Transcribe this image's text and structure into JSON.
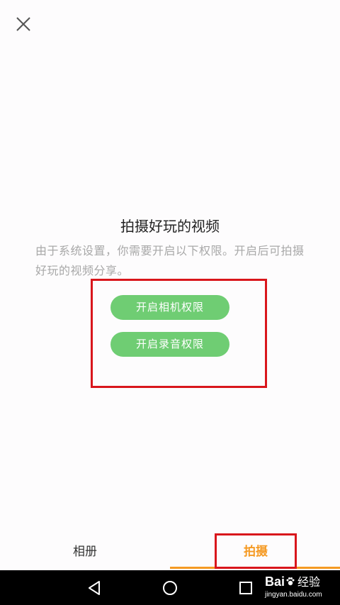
{
  "header": {
    "close_icon": "close-icon"
  },
  "permission": {
    "title": "拍摄好玩的视频",
    "description": "由于系统设置，你需要开启以下权限。开启后可拍摄好玩的视频分享。",
    "camera_button_label": "开启相机权限",
    "audio_button_label": "开启录音权限"
  },
  "tabs": {
    "album_label": "相册",
    "shoot_label": "拍摄",
    "active": "shoot"
  },
  "system_nav": {
    "back_icon": "triangle-back-icon",
    "home_icon": "circle-home-icon",
    "recent_icon": "square-recent-icon"
  },
  "watermark": {
    "brand_left": "Bai",
    "brand_right": "经验",
    "url": "jingyan.baidu.com"
  },
  "colors": {
    "accent_orange": "#f59a23",
    "button_green": "#6fcd73",
    "highlight_red": "#d9161c",
    "description_gray": "#a8a8a8"
  }
}
